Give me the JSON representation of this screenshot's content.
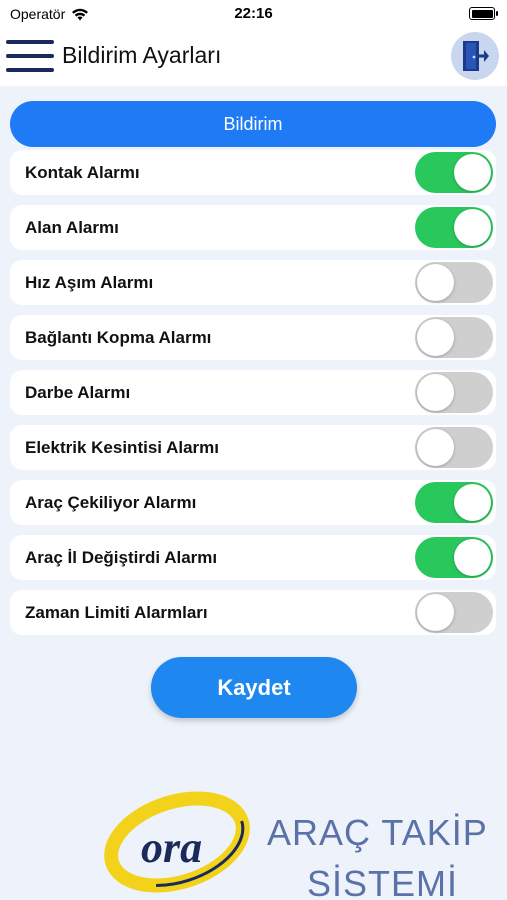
{
  "status_bar": {
    "carrier": "Operatör",
    "time": "22:16"
  },
  "header": {
    "title": "Bildirim Ayarları"
  },
  "section": {
    "title": "Bildirim"
  },
  "alarms": [
    {
      "label": "Kontak Alarmı",
      "on": true
    },
    {
      "label": "Alan Alarmı",
      "on": true
    },
    {
      "label": "Hız Aşım Alarmı",
      "on": false
    },
    {
      "label": "Bağlantı Kopma Alarmı",
      "on": false
    },
    {
      "label": "Darbe Alarmı",
      "on": false
    },
    {
      "label": "Elektrik Kesintisi Alarmı",
      "on": false
    },
    {
      "label": "Araç Çekiliyor Alarmı",
      "on": true
    },
    {
      "label": "Araç İl Değiştirdi Alarmı",
      "on": true
    },
    {
      "label": "Zaman Limiti Alarmları",
      "on": false
    }
  ],
  "save_label": "Kaydet",
  "brand": {
    "logo_text": "ora",
    "line1": "ARAÇ TAKİP",
    "line2": "SİSTEMİ"
  },
  "colors": {
    "accent": "#1e7bf5",
    "toggle_on": "#29c85c",
    "toggle_off": "#cfcfcf",
    "background": "#eef3fb"
  }
}
